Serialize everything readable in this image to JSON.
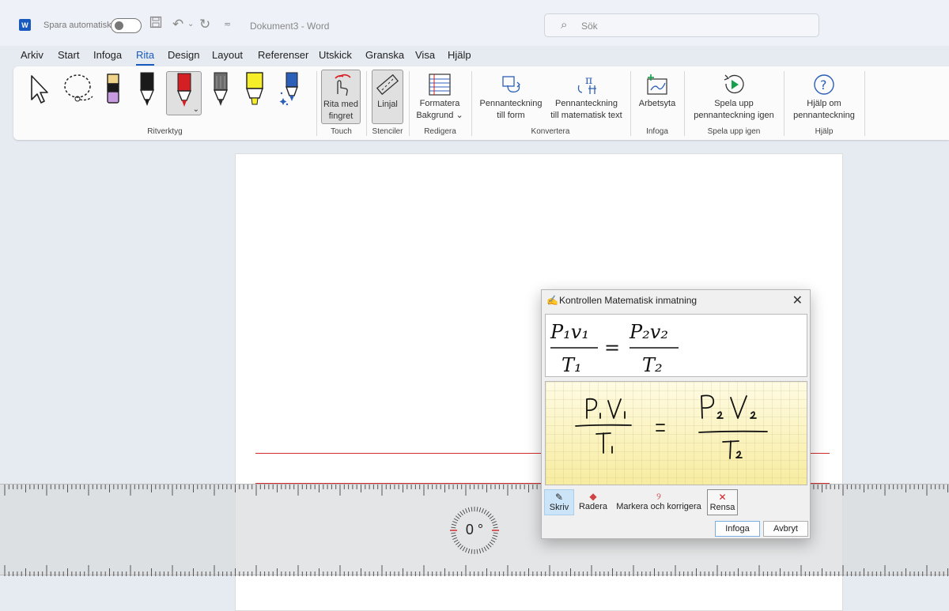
{
  "titlebar": {
    "app_badge": "W",
    "autosave_label": "Spara automatiskt",
    "document_title": "Dokument3  -  Word",
    "search_placeholder": "Sök",
    "accent_color": "#185abd"
  },
  "menu": {
    "tabs": [
      "Arkiv",
      "Start",
      "Infoga",
      "Rita",
      "Design",
      "Layout",
      "Referenser",
      "Utskick",
      "Granska",
      "Visa",
      "Hjälp"
    ],
    "active": "Rita"
  },
  "ribbon": {
    "groups": {
      "ritverktyg": "Ritverktyg",
      "touch": "Touch",
      "stenciler": "Stenciler",
      "redigera": "Redigera",
      "konvertera": "Konvertera",
      "infoga": "Infoga",
      "spela": "Spela upp igen",
      "hjalp": "Hjälp"
    },
    "buttons": {
      "rita_med_fingret": [
        "Rita med",
        "fingret"
      ],
      "linjal": "Linjal",
      "formatera_bakgrund": [
        "Formatera",
        "Bakgrund ⌄"
      ],
      "pen_to_shape": [
        "Pennanteckning",
        "till form"
      ],
      "pen_to_math": [
        "Pennanteckning",
        "till matematisk text"
      ],
      "arbetsyta": "Arbetsyta",
      "replay": [
        "Spela upp",
        "pennanteckning igen"
      ],
      "help": [
        "Hjälp om",
        "pennanteckning"
      ]
    },
    "pens": [
      {
        "icon": "black-pen-icon",
        "color": "#1a1a1a"
      },
      {
        "icon": "red-pen-icon",
        "color": "#d41f25"
      },
      {
        "icon": "pencil-icon",
        "color": "#555555"
      },
      {
        "icon": "yellow-highlighter-icon",
        "color": "#f7ee2a"
      },
      {
        "icon": "galaxy-pen-icon",
        "color": "#2c5fb8"
      }
    ]
  },
  "ruler": {
    "angle": "0 °"
  },
  "math_dialog": {
    "title": "Kontrollen Matematisk inmatning",
    "close_glyph": "✕",
    "tools": {
      "skriv": "Skriv",
      "radera": "Radera",
      "markera": "Markera och korrigera",
      "rensa": "Rensa"
    },
    "buttons": {
      "infoga": "Infoga",
      "avbryt": "Avbryt"
    },
    "equation": {
      "lhs_num": "P₁v₁",
      "lhs_den": "T₁",
      "rhs_num": "P₂v₂",
      "rhs_den": "T₂",
      "equals": "="
    }
  }
}
